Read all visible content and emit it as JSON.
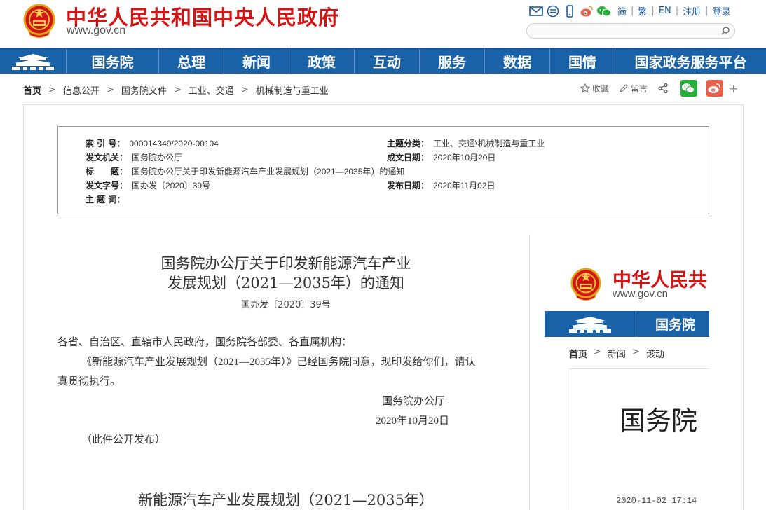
{
  "header": {
    "site_title": "中华人民共和国中央人民政府",
    "site_url": "www.gov.cn",
    "links": [
      "简",
      "繁",
      "EN",
      "注册",
      "登录"
    ],
    "search_placeholder": ""
  },
  "nav": {
    "items": [
      "国务院",
      "总理",
      "新闻",
      "政策",
      "互动",
      "服务",
      "数据",
      "国情",
      "国家政务服务平台"
    ]
  },
  "breadcrumb": [
    "首页",
    "信息公开",
    "国务院文件",
    "工业、交通",
    "机械制造与重工业"
  ],
  "share": {
    "favorite": "收藏",
    "comment": "留言",
    "more": "+"
  },
  "meta": {
    "index_label": "索 引 号：",
    "index_value": "000014349/2020-00104",
    "category_label": "主题分类：",
    "category_value": "工业、交通\\机械制造与重工业",
    "issuer_label": "发文机关：",
    "issuer_value": "国务院办公厅",
    "created_label": "成文日期：",
    "created_value": "2020年10月20日",
    "title_label": "标　　题：",
    "title_value": "国务院办公厅关于印发新能源汽车产业发展规划（2021—2035年）的通知",
    "docno_label": "发文字号：",
    "docno_value": "国办发〔2020〕39号",
    "published_label": "发布日期：",
    "published_value": "2020年11月02日",
    "keywords_label": "主 题 词：",
    "keywords_value": ""
  },
  "article": {
    "title_line1": "国务院办公厅关于印发新能源汽车产业",
    "title_line2": "发展规划（2021—2035年）的通知",
    "doc_no": "国办发〔2020〕39号",
    "recipients": "各省、自治区、直辖市人民政府，国务院各部委、各直属机构：",
    "body_line1": "《新能源汽车产业发展规划（2021—2035年）》已经国务院同意，现印发给你们，请认",
    "body_line2": "真贯彻执行。",
    "signature": "国务院办公厅",
    "date": "2020年10月20日",
    "note": "（此件公开发布）",
    "title2": "新能源汽车产业发展规划（2021—2035年）"
  },
  "widget": {
    "title": "中华人民共",
    "url": "www.gov.cn",
    "nav_item": "国务院",
    "crumbs": [
      "首页",
      "新闻",
      "滚动"
    ],
    "big_text": "国务院",
    "time": "2020-11-02 17:14"
  },
  "colors": {
    "brand_red": "#d41515",
    "nav_blue": "#1a62a8",
    "wechat_green": "#2aae3b",
    "weibo_red": "#e8604c"
  }
}
